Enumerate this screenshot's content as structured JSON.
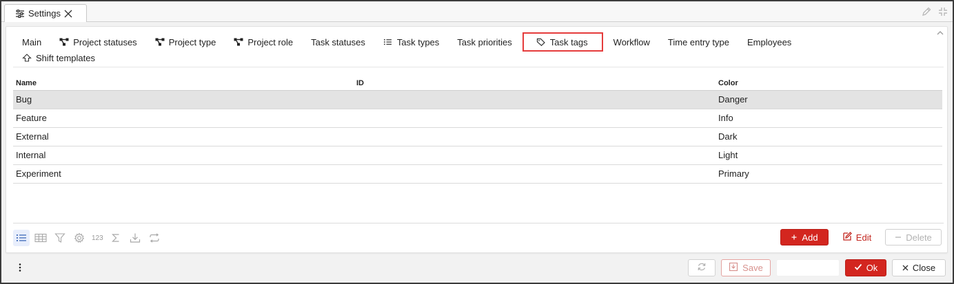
{
  "window": {
    "tab_title": "Settings",
    "tab_icon": "sliders-icon",
    "close_icon": "close-icon",
    "tools": [
      "pencil-icon",
      "collapse-icon"
    ]
  },
  "tabs": [
    {
      "label": "Main",
      "icon": null
    },
    {
      "label": "Project statuses",
      "icon": "network-icon"
    },
    {
      "label": "Project type",
      "icon": "network-icon"
    },
    {
      "label": "Project role",
      "icon": "network-icon"
    },
    {
      "label": "Task statuses",
      "icon": null
    },
    {
      "label": "Task types",
      "icon": "list-icon"
    },
    {
      "label": "Task priorities",
      "icon": null
    },
    {
      "label": "Task tags",
      "icon": "tag-icon",
      "active": true
    },
    {
      "label": "Workflow",
      "icon": null
    },
    {
      "label": "Time entry type",
      "icon": null
    },
    {
      "label": "Employees",
      "icon": null
    },
    {
      "label": "Shift templates",
      "icon": "arrow-up-icon"
    }
  ],
  "grid": {
    "columns": [
      "Name",
      "ID",
      "Color"
    ],
    "rows": [
      {
        "name": "Bug",
        "id": "",
        "color": "Danger",
        "selected": true
      },
      {
        "name": "Feature",
        "id": "",
        "color": "Info"
      },
      {
        "name": "External",
        "id": "",
        "color": "Dark"
      },
      {
        "name": "Internal",
        "id": "",
        "color": "Light"
      },
      {
        "name": "Experiment",
        "id": "",
        "color": "Primary"
      }
    ]
  },
  "toolbar": {
    "number_label": "123",
    "add_label": "Add",
    "edit_label": "Edit",
    "delete_label": "Delete"
  },
  "footer": {
    "save_label": "Save",
    "ok_label": "Ok",
    "close_label": "Close"
  },
  "colors": {
    "accent": "#d3261f",
    "active_tab_border": "#e53b3b",
    "selected_row": "#e3e3e3"
  }
}
